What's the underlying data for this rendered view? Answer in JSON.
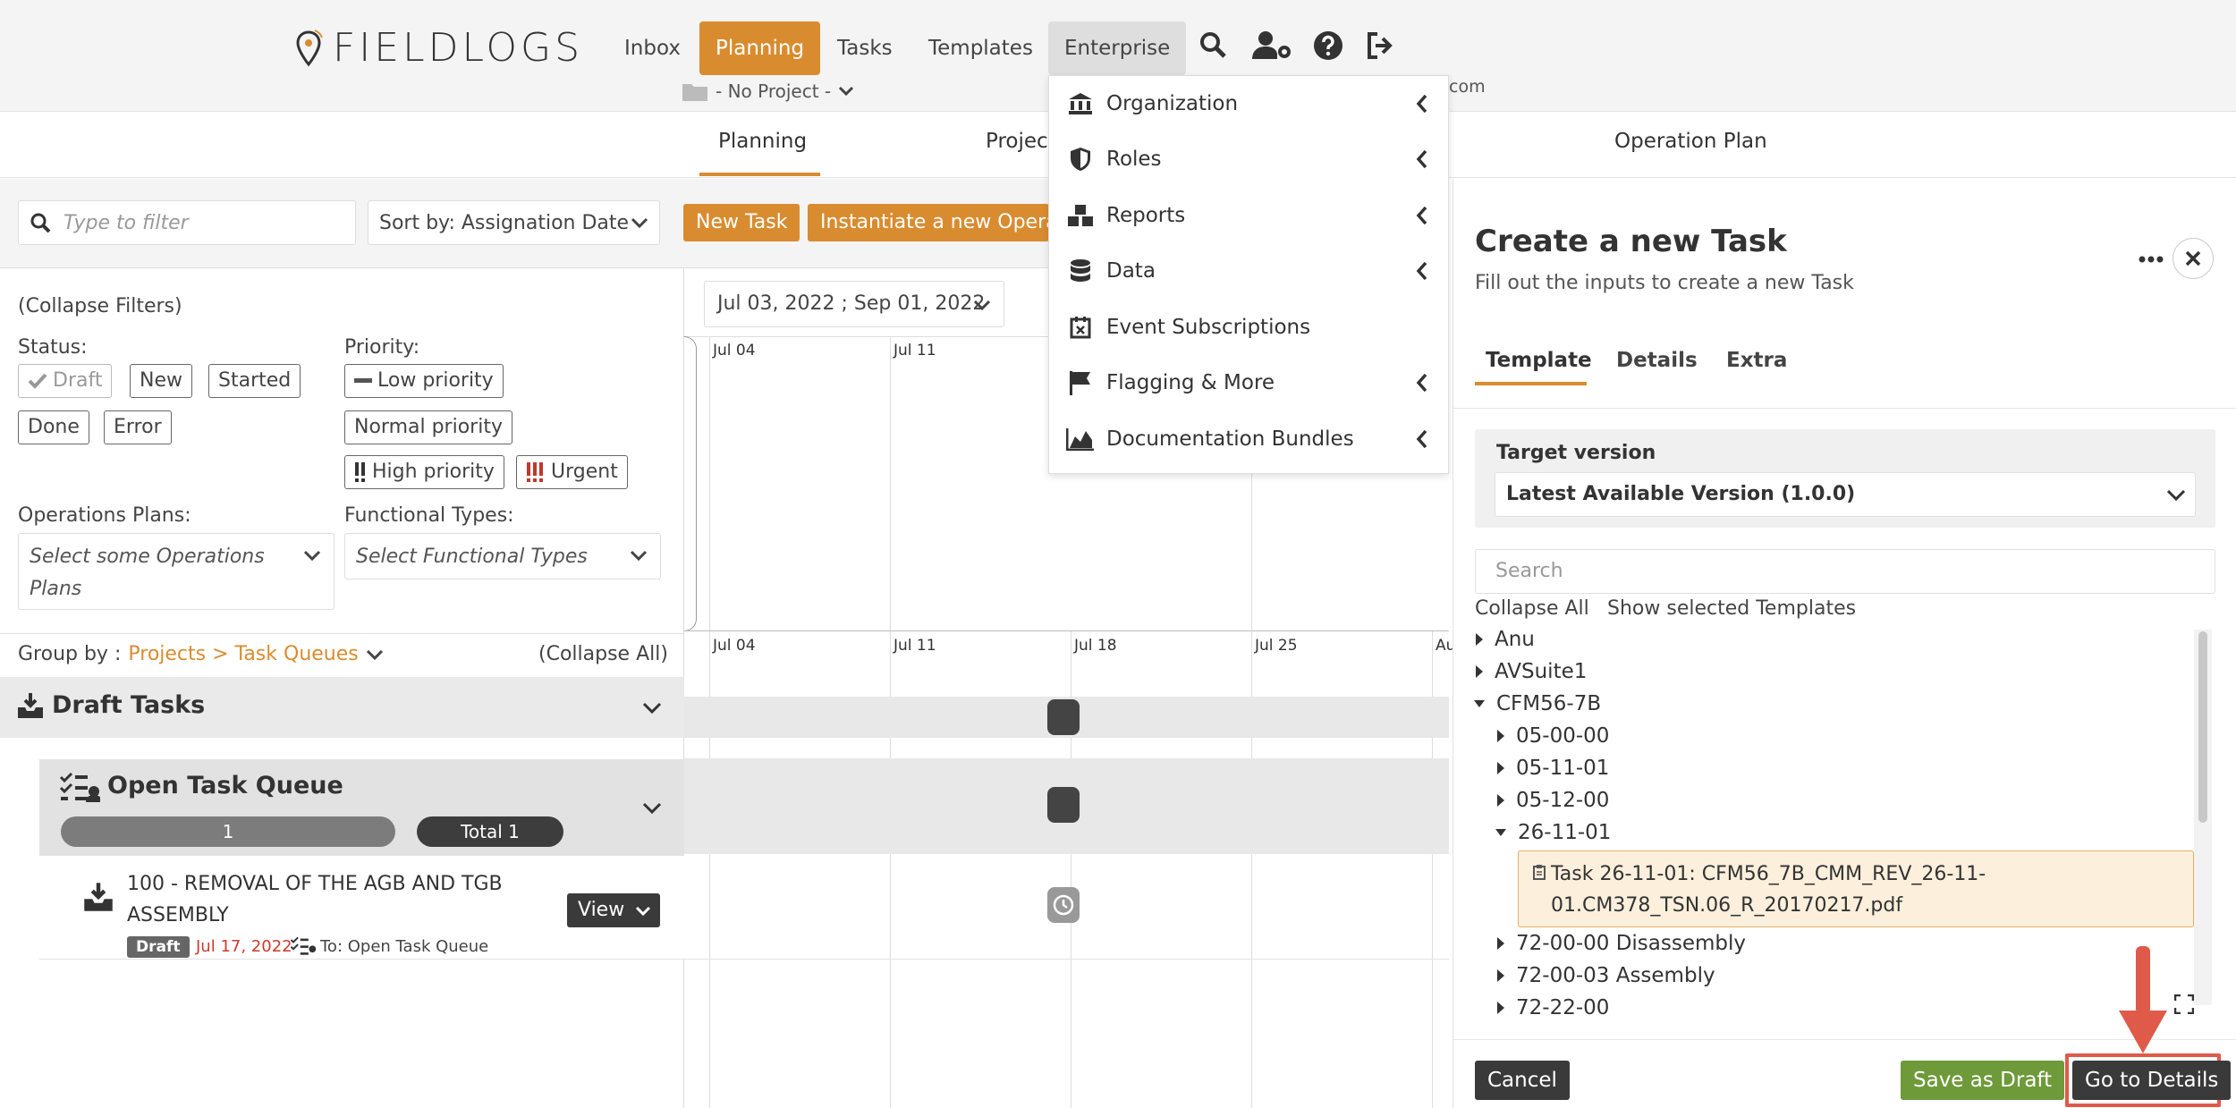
{
  "brand": {
    "name": "FIELDLOGS"
  },
  "nav": {
    "inbox": "Inbox",
    "planning": "Planning",
    "tasks": "Tasks",
    "templates": "Templates",
    "enterprise": "Enterprise"
  },
  "project_selector": "- No Project -",
  "email_fragment": "com",
  "subtabs": {
    "planning": "Planning",
    "projects": "Project",
    "operation_plan": "Operation Plan"
  },
  "toolbar": {
    "filter_placeholder": "Type to filter",
    "sort_label": "Sort by: Assignation Date",
    "new_task": "New Task",
    "instantiate": "Instantiate a new Operat"
  },
  "filters": {
    "collapse": "(Collapse Filters)",
    "status_label": "Status:",
    "status": [
      "Draft",
      "New",
      "Started",
      "Done",
      "Error"
    ],
    "priority_label": "Priority:",
    "priority": [
      "Low priority",
      "Normal priority",
      "High priority",
      "Urgent"
    ],
    "ops_label": "Operations Plans:",
    "ops_placeholder": "Select some Operations Plans",
    "ftypes_label": "Functional Types:",
    "ftypes_placeholder": "Select Functional Types"
  },
  "groupby": {
    "label": "Group by :",
    "value": "Projects > Task Queues",
    "collapse_all": "(Collapse All)"
  },
  "draft_tasks": "Draft Tasks",
  "queue": {
    "title": "Open Task Queue",
    "count": "1",
    "total": "Total 1"
  },
  "task": {
    "title": "100 - REMOVAL OF THE AGB AND TGB ASSEMBLY",
    "status": "Draft",
    "date": "Jul 17, 2022",
    "assignee": "To: Open Task Queue",
    "view": "View"
  },
  "gantt": {
    "range": "Jul 03, 2022 ; Sep 01, 2022",
    "top_ticks": [
      "Jul 04",
      "Jul 11"
    ],
    "bottom_ticks": [
      "Jul 04",
      "Jul 11",
      "Jul 18",
      "Jul 25",
      "Au"
    ]
  },
  "enterprise_menu": [
    "Organization",
    "Roles",
    "Reports",
    "Data",
    "Event Subscriptions",
    "Flagging & More",
    "Documentation Bundles"
  ],
  "panel": {
    "title": "Create a new Task",
    "subtitle": "Fill out the inputs to create a new Task",
    "tabs": [
      "Template",
      "Details",
      "Extra"
    ],
    "target_label": "Target version",
    "target_value": "Latest Available Version (1.0.0)",
    "search_placeholder": "Search",
    "collapse_all": "Collapse All",
    "show_selected": "Show selected Templates",
    "tree": [
      "Anu",
      "AVSuite1",
      "CFM56-7B",
      "05-00-00",
      "05-11-01",
      "05-12-00",
      "26-11-01",
      "72-00-00 Disassembly",
      "72-00-03 Assembly",
      "72-22-00"
    ],
    "selected_line1": "Task 26-11-01: CFM56_7B_CMM_REV_26-11-",
    "selected_line2": "01.CM378_TSN.06_R_20170217.pdf",
    "cancel": "Cancel",
    "save_draft": "Save as Draft",
    "go_details": "Go to Details"
  },
  "colors": {
    "accent": "#d98c2f",
    "green": "#6e9a3a",
    "dark": "#3a3a3a",
    "urgent": "#c0392b",
    "highlight": "#e05a4a"
  }
}
